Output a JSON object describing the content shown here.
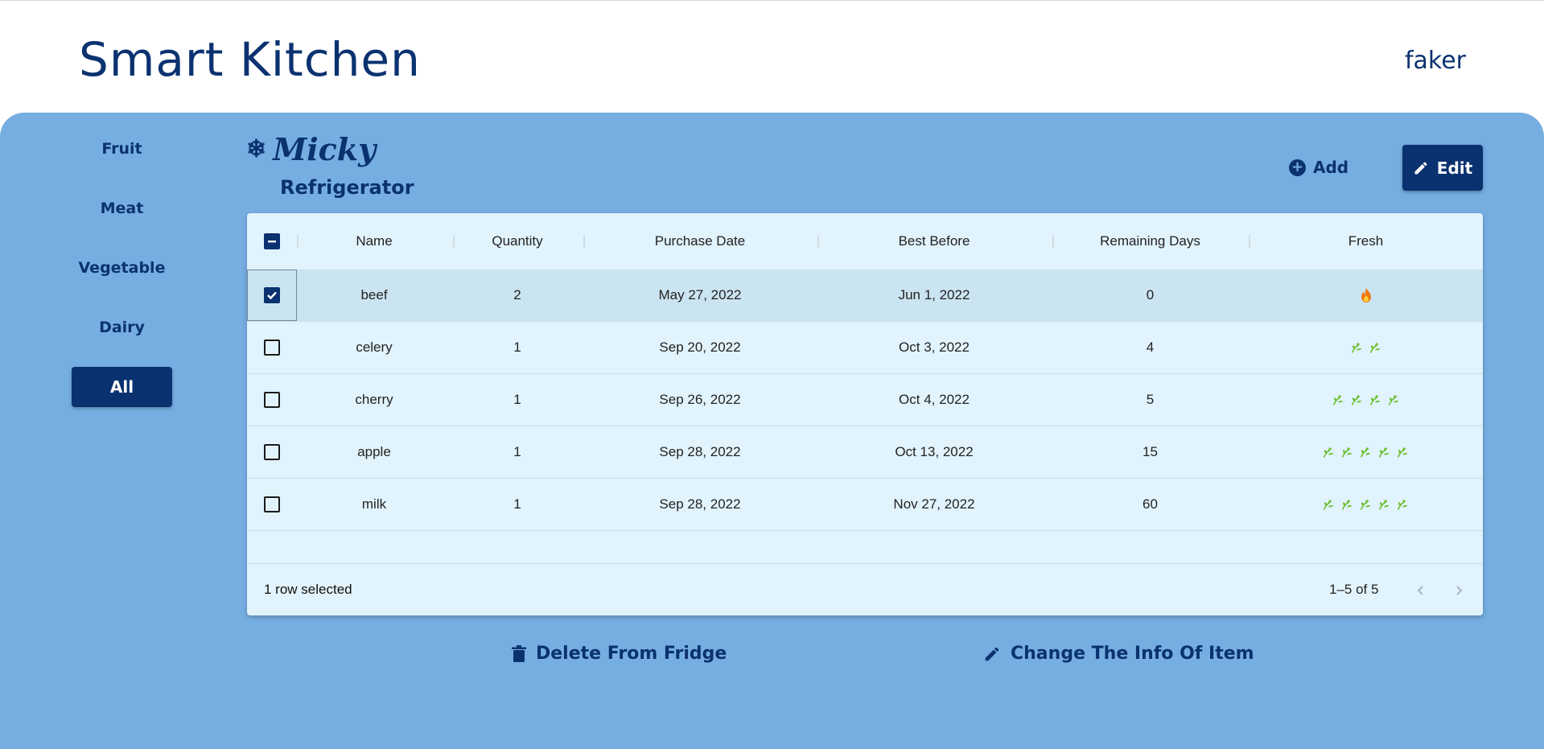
{
  "header": {
    "app_title": "Smart Kitchen",
    "user_name": "faker"
  },
  "categories": [
    {
      "label": "Fruit",
      "active": false
    },
    {
      "label": "Meat",
      "active": false
    },
    {
      "label": "Vegetable",
      "active": false
    },
    {
      "label": "Dairy",
      "active": false
    },
    {
      "label": "All",
      "active": true
    }
  ],
  "fridge": {
    "name": "Micky",
    "type": "Refrigerator"
  },
  "toolbar": {
    "add_label": "Add",
    "edit_label": "Edit"
  },
  "table": {
    "columns": [
      "Name",
      "Quantity",
      "Purchase Date",
      "Best Before",
      "Remaining Days",
      "Fresh"
    ],
    "rows": [
      {
        "name": "beef",
        "quantity": "2",
        "purchase_date": "May 27, 2022",
        "best_before": "Jun 1, 2022",
        "remaining_days": "0",
        "fresh_icon": "fire-icon",
        "fresh_count": 1,
        "selected": true
      },
      {
        "name": "celery",
        "quantity": "1",
        "purchase_date": "Sep 20, 2022",
        "best_before": "Oct 3, 2022",
        "remaining_days": "4",
        "fresh_icon": "leaf-icon",
        "fresh_count": 2,
        "selected": false
      },
      {
        "name": "cherry",
        "quantity": "1",
        "purchase_date": "Sep 26, 2022",
        "best_before": "Oct 4, 2022",
        "remaining_days": "5",
        "fresh_icon": "leaf-icon",
        "fresh_count": 4,
        "selected": false
      },
      {
        "name": "apple",
        "quantity": "1",
        "purchase_date": "Sep 28, 2022",
        "best_before": "Oct 13, 2022",
        "remaining_days": "15",
        "fresh_icon": "leaf-icon",
        "fresh_count": 5,
        "selected": false
      },
      {
        "name": "milk",
        "quantity": "1",
        "purchase_date": "Sep 28, 2022",
        "best_before": "Nov 27, 2022",
        "remaining_days": "60",
        "fresh_icon": "leaf-icon",
        "fresh_count": 5,
        "selected": false
      }
    ],
    "footer": {
      "selected_text": "1 row selected",
      "pagination": "1–5 of 5"
    }
  },
  "actions": {
    "delete_label": "Delete From Fridge",
    "change_label": "Change The Info Of Item"
  },
  "colors": {
    "brand": "#0b3270",
    "panel": "#76aee2",
    "grid_bg": "#e1f3fc",
    "leaf": "#6abf2e",
    "fire": "#f07a10"
  }
}
